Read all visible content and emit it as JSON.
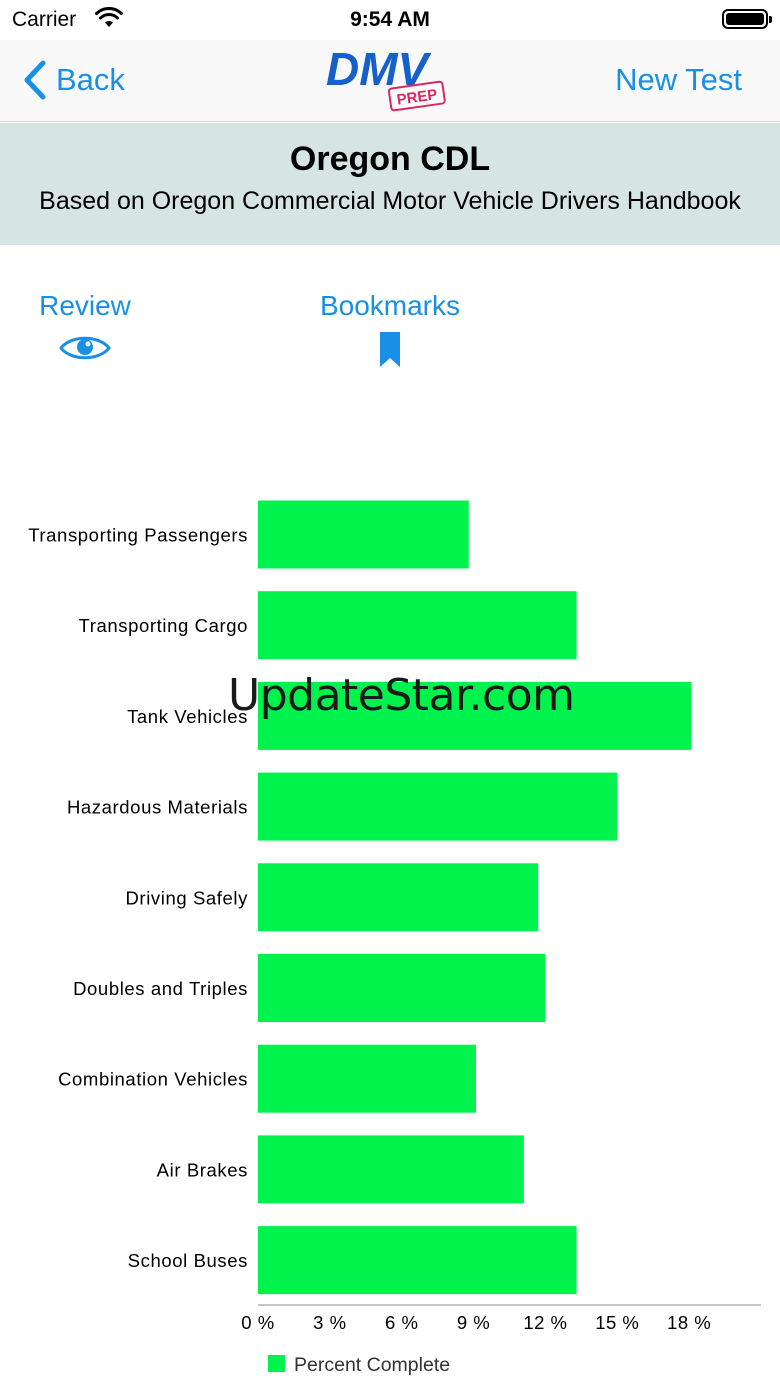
{
  "status_bar": {
    "carrier": "Carrier",
    "time": "9:54 AM"
  },
  "nav": {
    "back_label": "Back",
    "logo_text": "DMV",
    "logo_badge": "PREP",
    "new_test_label": "New Test"
  },
  "banner": {
    "title": "Oregon CDL",
    "subtitle": "Based on Oregon Commercial Motor Vehicle Drivers Handbook"
  },
  "actions": {
    "review_label": "Review",
    "review_icon": "eye-icon",
    "bookmarks_label": "Bookmarks",
    "bookmarks_icon": "bookmark-icon"
  },
  "watermark": "UpdateStar.com",
  "colors": {
    "accent": "#1a8fe6",
    "bar": "#00f24c",
    "banner_bg": "#d6e5e4",
    "logo_red": "#e0265a"
  },
  "chart_data": {
    "type": "bar",
    "orientation": "horizontal",
    "categories": [
      "Transporting Passengers",
      "Transporting Cargo",
      "Tank Vehicles",
      "Hazardous Materials",
      "Driving Safely",
      "Doubles and Triples",
      "Combination Vehicles",
      "Air Brakes",
      "School Buses"
    ],
    "series": [
      {
        "name": "Percent Complete",
        "values": [
          8.8,
          13.3,
          18.1,
          15.0,
          11.7,
          12.0,
          9.1,
          11.1,
          13.3
        ]
      }
    ],
    "xlim": [
      0,
      21
    ],
    "xticks": [
      0,
      3,
      6,
      9,
      12,
      15,
      18
    ],
    "xtick_labels": [
      "0 %",
      "3 %",
      "6 %",
      "9 %",
      "12 %",
      "15 %",
      "18 %"
    ],
    "legend": "bottom-left"
  }
}
